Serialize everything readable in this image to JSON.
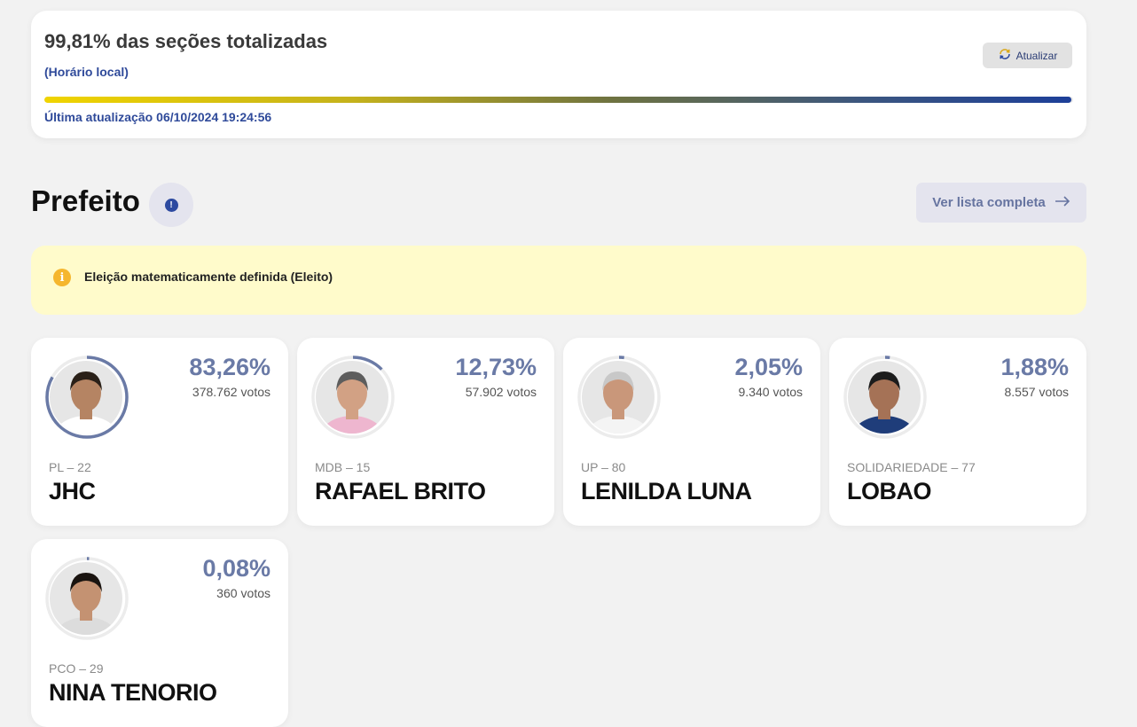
{
  "status": {
    "title": "99,81% das seções totalizadas",
    "local_time_label": "(Horário local)",
    "refresh_label": "Atualizar",
    "progress_fraction": 0.9981,
    "last_update_label": "Última atualização",
    "last_update_value": "06/10/2024 19:24:56"
  },
  "section": {
    "title": "Prefeito",
    "info_glyph": "!",
    "full_list_label": "Ver lista completa"
  },
  "alert": {
    "icon": "info-icon",
    "glyph": "i",
    "text": "Eleição matematicamente definida (Eleito)"
  },
  "colors": {
    "accent": "#6a7aa6",
    "brand_blue": "#2f4a9a",
    "alert_bg": "#fffbcb",
    "alert_icon": "#f5b62e"
  },
  "vote_word": "votos",
  "candidates": [
    {
      "name": "JHC",
      "party": "PL – 22",
      "percent": "83,26%",
      "share": 0.8326,
      "votes": "378.762",
      "skin": "#b58463",
      "hair": "#2a2018",
      "shirt": "#ffffff"
    },
    {
      "name": "RAFAEL BRITO",
      "party": "MDB – 15",
      "percent": "12,73%",
      "share": 0.1273,
      "votes": "57.902",
      "skin": "#d2a184",
      "hair": "#5d5d5d",
      "shirt": "#eeb6cf"
    },
    {
      "name": "LENILDA LUNA",
      "party": "UP – 80",
      "percent": "2,05%",
      "share": 0.0205,
      "votes": "9.340",
      "skin": "#c9977a",
      "hair": "#c8c8c8",
      "shirt": "#f4f4f4"
    },
    {
      "name": "LOBAO",
      "party": "SOLIDARIEDADE – 77",
      "percent": "1,88%",
      "share": 0.0188,
      "votes": "8.557",
      "skin": "#a57256",
      "hair": "#1c1c1c",
      "shirt": "#1f3d7a"
    },
    {
      "name": "NINA TENORIO",
      "party": "PCO – 29",
      "percent": "0,08%",
      "share": 0.0008,
      "votes": "360",
      "skin": "#c49272",
      "hair": "#1a1410",
      "shirt": "#dcdcdc"
    }
  ]
}
